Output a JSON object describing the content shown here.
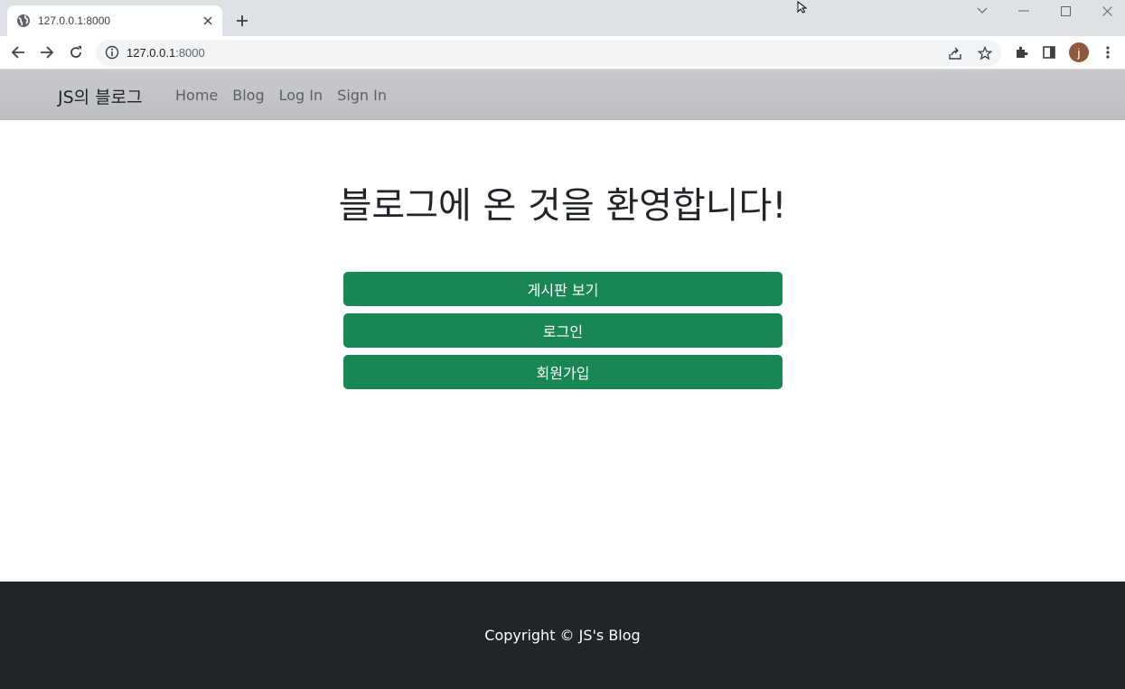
{
  "browser": {
    "tab": {
      "title": "127.0.0.1:8000",
      "favicon": "globe-icon"
    },
    "address": {
      "host": "127.0.0.1",
      "port": ":8000"
    },
    "profile_initial": "j"
  },
  "navbar": {
    "brand": "JS의 블로그",
    "links": [
      "Home",
      "Blog",
      "Log In",
      "Sign In"
    ]
  },
  "main": {
    "title": "블로그에 온 것을 환영합니다!",
    "buttons": [
      "게시판 보기",
      "로그인",
      "회원가입"
    ],
    "button_color": "#198754"
  },
  "footer": {
    "text": "Copyright © JS's Blog",
    "background": "#212529"
  }
}
